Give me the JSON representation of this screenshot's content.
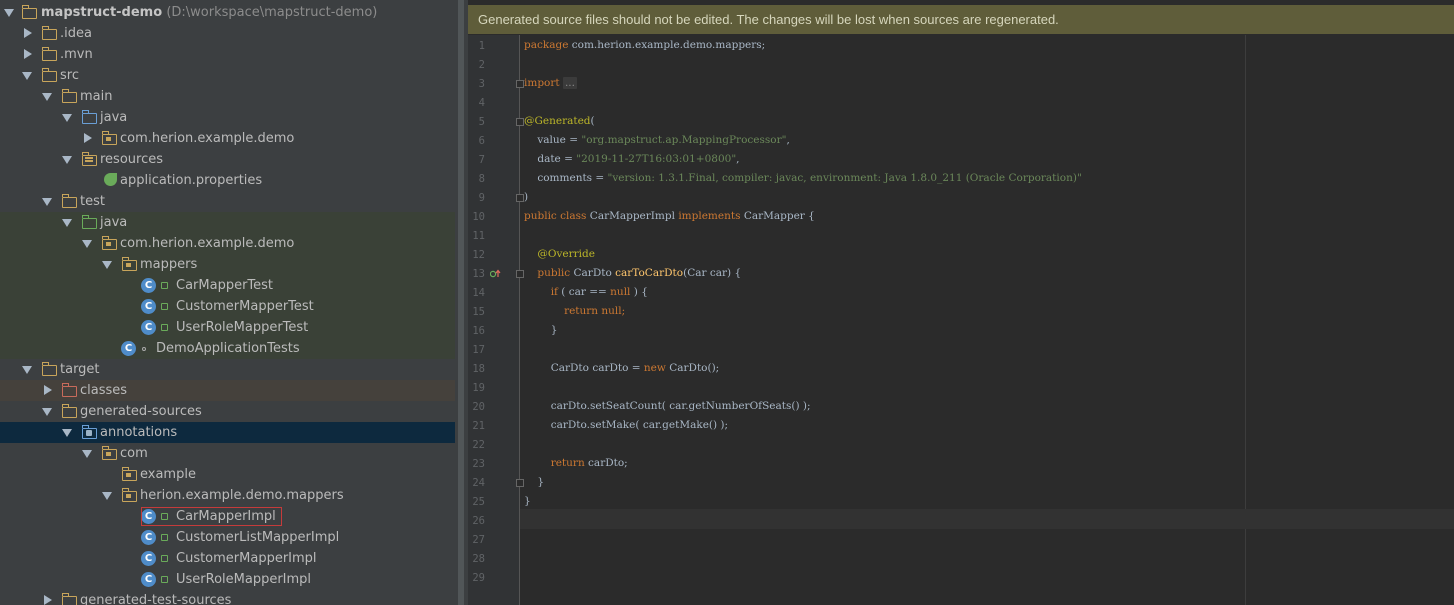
{
  "project_tree": {
    "rows": [
      {
        "label": "mapstruct-demo",
        "path": "(D:\\workspace\\mapstruct-demo)"
      },
      {
        "label": ".idea"
      },
      {
        "label": ".mvn"
      },
      {
        "label": "src"
      },
      {
        "label": "main"
      },
      {
        "label": "java"
      },
      {
        "label": "com.herion.example.demo"
      },
      {
        "label": "resources"
      },
      {
        "label": "application.properties"
      },
      {
        "label": "test"
      },
      {
        "label": "java"
      },
      {
        "label": "com.herion.example.demo"
      },
      {
        "label": "mappers"
      },
      {
        "label": "CarMapperTest"
      },
      {
        "label": "CustomerMapperTest"
      },
      {
        "label": "UserRoleMapperTest"
      },
      {
        "label": "DemoApplicationTests"
      },
      {
        "label": "target"
      },
      {
        "label": "classes"
      },
      {
        "label": "generated-sources"
      },
      {
        "label": "annotations"
      },
      {
        "label": "com"
      },
      {
        "label": "example"
      },
      {
        "label": "herion.example.demo.mappers"
      },
      {
        "label": "CarMapperImpl"
      },
      {
        "label": "CustomerListMapperImpl"
      },
      {
        "label": "CustomerMapperImpl"
      },
      {
        "label": "UserRoleMapperImpl"
      },
      {
        "label": "generated-test-sources"
      }
    ],
    "class_badge": "C"
  },
  "editor": {
    "banner": "Generated source files should not be edited. The changes will be lost when sources are regenerated.",
    "line_numbers": [
      "1",
      "2",
      "3",
      "4",
      "5",
      "6",
      "7",
      "8",
      "9",
      "10",
      "11",
      "12",
      "13",
      "14",
      "15",
      "16",
      "17",
      "18",
      "19",
      "20",
      "21",
      "22",
      "23",
      "24",
      "25",
      "26",
      "27",
      "28",
      "29"
    ],
    "code": {
      "l1": "com.herion.example.demo.mappers;",
      "kw_package": "package",
      "kw_import": "import",
      "import_dots": "...",
      "l8": "@Generated",
      "l9_key": "value",
      "l9_val": "\"org.mapstruct.ap.MappingProcessor\"",
      "l10_key": "date",
      "l10_val": "\"2019-11-27T16:03:01+0800\"",
      "l11_key": "comments",
      "l11_val": "\"version: 1.3.1.Final, compiler: javac, environment: Java 1.8.0_211 (Oracle Corporation)\"",
      "kw_public": "public",
      "kw_class": "class",
      "class_name": "CarMapperImpl",
      "kw_implements": "implements",
      "iface": "CarMapper",
      "override": "@Override",
      "ret_type": "CarDto",
      "method": "carToCarDto",
      "params": "(Car car)",
      "kw_if": "if",
      "cond": "( car == ",
      "kw_null": "null",
      "kw_return": "return",
      "l21_a": "CarDto carDto = ",
      "kw_new": "new",
      "l21_b": "CarDto();",
      "l23": "carDto.setSeatCount( car.getNumberOfSeats() );",
      "l24": "carDto.setMake( car.getMake() );",
      "l26": "carDto;"
    }
  }
}
